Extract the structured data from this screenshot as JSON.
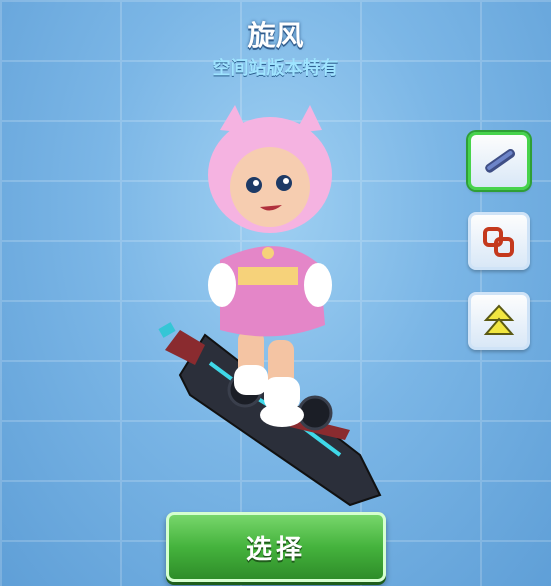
{
  "header": {
    "title": "旋风",
    "subtitle": "空间站版本特有"
  },
  "side_tabs": [
    {
      "icon": "board-icon",
      "selected": true
    },
    {
      "icon": "power-ups-icon",
      "selected": false
    },
    {
      "icon": "upgrade-icon",
      "selected": false
    }
  ],
  "action": {
    "select_label": "选择"
  },
  "colors": {
    "accent_green": "#45b33d",
    "subtitle_blue": "#9fe4ff"
  }
}
